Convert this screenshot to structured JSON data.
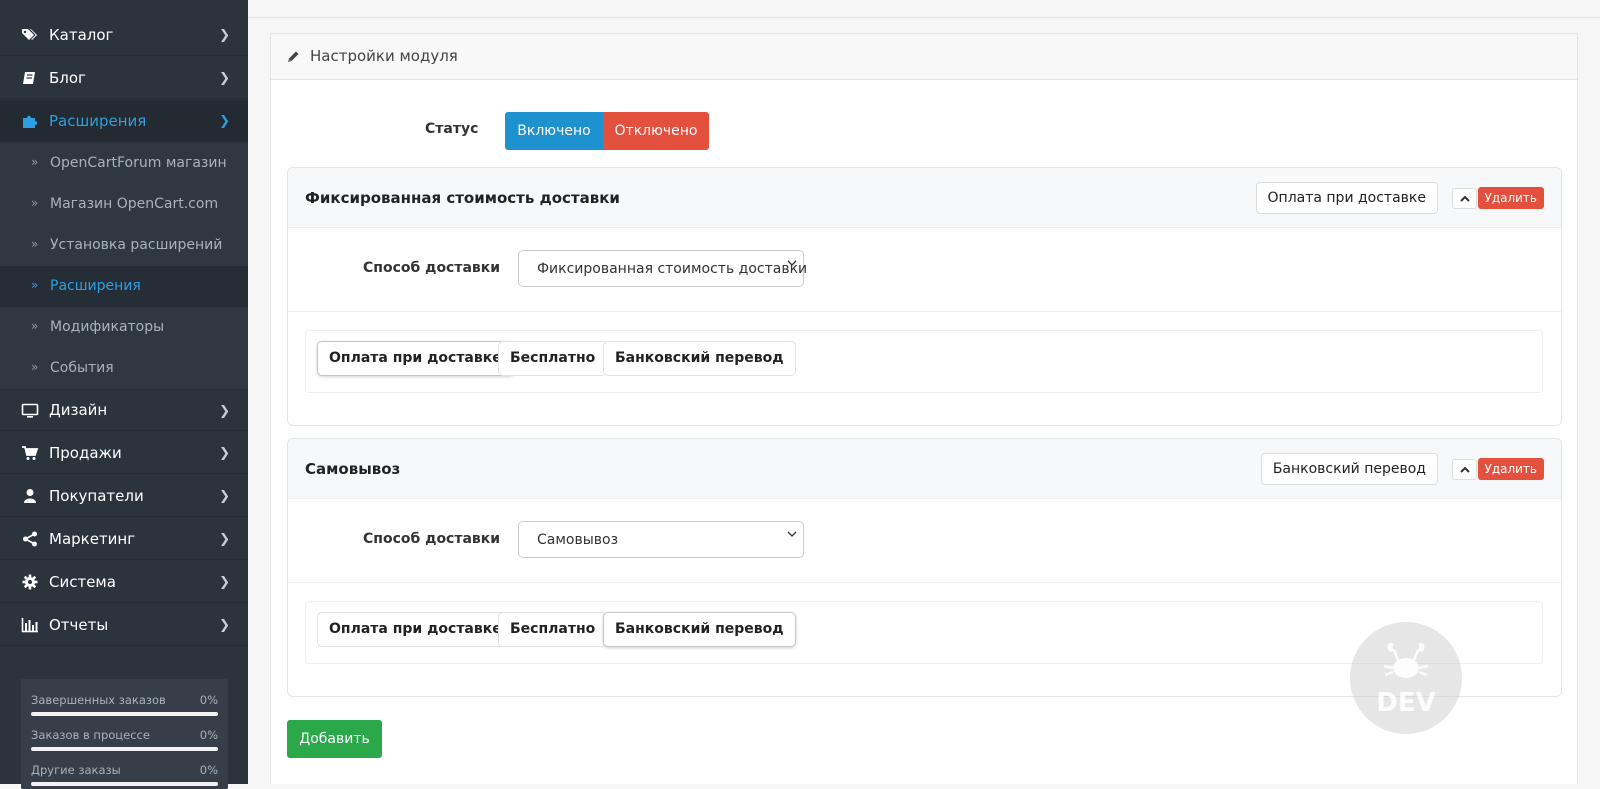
{
  "sidebar": {
    "items": [
      {
        "label": "Каталог",
        "icon": "tags-icon"
      },
      {
        "label": "Блог",
        "icon": "book-icon"
      },
      {
        "label": "Расширения",
        "icon": "puzzle-icon",
        "active": true
      },
      {
        "label": "Дизайн",
        "icon": "monitor-icon"
      },
      {
        "label": "Продажи",
        "icon": "cart-icon"
      },
      {
        "label": "Покупатели",
        "icon": "user-icon"
      },
      {
        "label": "Маркетинг",
        "icon": "share-icon"
      },
      {
        "label": "Система",
        "icon": "gear-icon"
      },
      {
        "label": "Отчеты",
        "icon": "bar-chart-icon"
      }
    ],
    "subitems": [
      {
        "label": "OpenCartForum магазин"
      },
      {
        "label": "Магазин OpenCart.com"
      },
      {
        "label": "Установка расширений"
      },
      {
        "label": "Расширения",
        "active": true
      },
      {
        "label": "Модификаторы"
      },
      {
        "label": "События"
      }
    ],
    "stats": [
      {
        "label": "Завершенных заказов",
        "value": "0%"
      },
      {
        "label": "Заказов в процессе",
        "value": "0%"
      },
      {
        "label": "Другие заказы",
        "value": "0%"
      }
    ]
  },
  "panel": {
    "title": "Настройки модуля",
    "status_label": "Статус",
    "status_on": "Включено",
    "status_off": "Отключено"
  },
  "blocks": [
    {
      "title": "Фиксированная стоимость доставки",
      "tag": "Оплата при доставке",
      "delete_label": "Удалить",
      "shipping_label": "Способ доставки",
      "shipping_value": "Фиксированная стоимость доставки",
      "payments": [
        {
          "label": "Оплата при доставке",
          "selected": true
        },
        {
          "label": "Бесплатно"
        },
        {
          "label": "Банковский перевод"
        }
      ]
    },
    {
      "title": "Самовывоз",
      "tag": "Банковский перевод",
      "delete_label": "Удалить",
      "shipping_label": "Способ доставки",
      "shipping_value": "Самовывоз",
      "payments": [
        {
          "label": "Оплата при доставке"
        },
        {
          "label": "Бесплатно"
        },
        {
          "label": "Банковский перевод",
          "selected": true
        }
      ]
    }
  ],
  "add_label": "Добавить",
  "watermark": "DEV",
  "colors": {
    "sidebar_bg": "#2b333d",
    "accent": "#1e91cf",
    "danger": "#e3503e",
    "success": "#2aa84a"
  }
}
